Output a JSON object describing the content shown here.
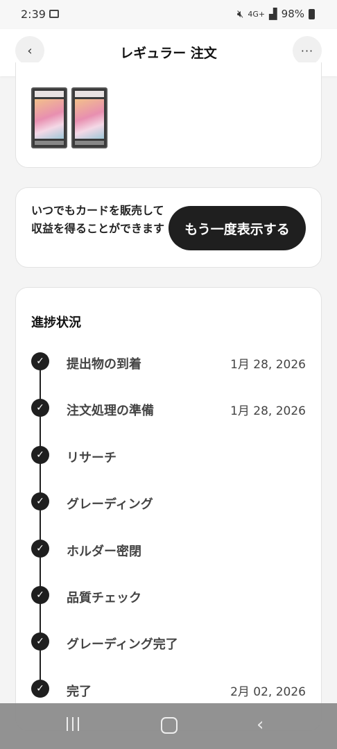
{
  "status_bar": {
    "time": "2:39",
    "network": "4G+",
    "battery": "98%"
  },
  "header": {
    "title": "レギュラー 注文",
    "back_icon": "‹",
    "more_icon": "···"
  },
  "sell_card": {
    "message": "いつでもカードを販売して収益を得ることができます",
    "button_label": "もう一度表示する"
  },
  "progress": {
    "title": "進捗状況",
    "steps": [
      {
        "label": "提出物の到着",
        "date": "1月 28, 2026"
      },
      {
        "label": "注文処理の準備",
        "date": "1月 28, 2026"
      },
      {
        "label": "リサーチ",
        "date": ""
      },
      {
        "label": "グレーディング",
        "date": ""
      },
      {
        "label": "ホルダー密閉",
        "date": ""
      },
      {
        "label": "品質チェック",
        "date": ""
      },
      {
        "label": "グレーディング完了",
        "date": ""
      },
      {
        "label": "完了",
        "date": "2月 02, 2026"
      }
    ]
  }
}
